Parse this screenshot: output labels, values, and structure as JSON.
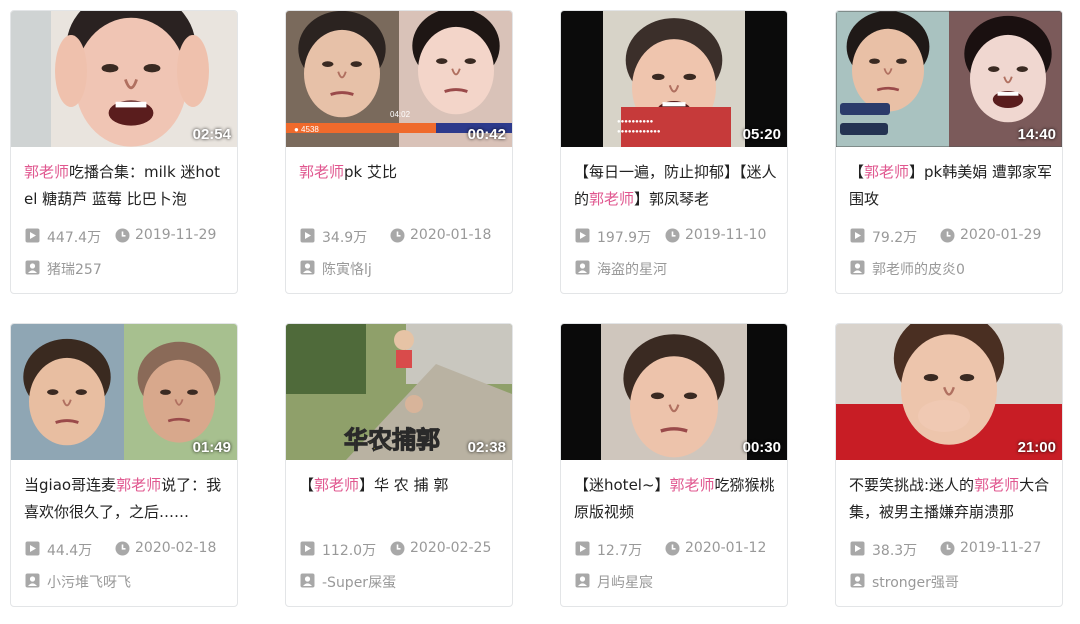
{
  "colors": {
    "highlight": "#e0578f",
    "meta": "#999999",
    "border": "#e3e5e7"
  },
  "videos": [
    {
      "duration": "02:54",
      "title_parts": [
        {
          "t": "郭老师",
          "hl": true
        },
        {
          "t": "吃播合集：milk 迷hotel 糖葫芦 蓝莓 比巴卜泡",
          "hl": false
        }
      ],
      "views": "447.4万",
      "date": "2019-11-29",
      "uploader": "猪瑞257",
      "thumb": "crying"
    },
    {
      "duration": "00:42",
      "title_parts": [
        {
          "t": "郭老师",
          "hl": true
        },
        {
          "t": "pk 艾比",
          "hl": false
        }
      ],
      "views": "34.9万",
      "date": "2020-01-18",
      "uploader": "陈寅恪lj",
      "thumb": "pk"
    },
    {
      "duration": "05:20",
      "title_parts": [
        {
          "t": "【每日一遍，防止抑郁】【迷人的",
          "hl": false
        },
        {
          "t": "郭老师",
          "hl": true
        },
        {
          "t": "】郭凤琴老",
          "hl": false
        }
      ],
      "views": "197.9万",
      "date": "2019-11-10",
      "uploader": "海盗的星河",
      "thumb": "live"
    },
    {
      "duration": "14:40",
      "title_parts": [
        {
          "t": "【",
          "hl": false
        },
        {
          "t": "郭老师",
          "hl": true
        },
        {
          "t": "】pk韩美娟 遭郭家军围攻",
          "hl": false
        }
      ],
      "views": "79.2万",
      "date": "2020-01-29",
      "uploader": "郭老师的皮炎0",
      "thumb": "pk2"
    },
    {
      "duration": "01:49",
      "title_parts": [
        {
          "t": "当giao哥连麦",
          "hl": false
        },
        {
          "t": "郭老师",
          "hl": true
        },
        {
          "t": "说了：我喜欢你很久了，之后……",
          "hl": false
        }
      ],
      "views": "44.4万",
      "date": "2020-02-18",
      "uploader": "小污堆飞呀飞",
      "thumb": "split"
    },
    {
      "duration": "02:38",
      "title_parts": [
        {
          "t": "【",
          "hl": false
        },
        {
          "t": "郭老师",
          "hl": true
        },
        {
          "t": "】华 农 捕 郭",
          "hl": false
        }
      ],
      "views": "112.0万",
      "date": "2020-02-25",
      "uploader": "-Super屎蛋",
      "thumb": "road",
      "overlay": "华农捕郭"
    },
    {
      "duration": "00:30",
      "title_parts": [
        {
          "t": "【迷hotel~】",
          "hl": false
        },
        {
          "t": "郭老师",
          "hl": true
        },
        {
          "t": "吃猕猴桃原版视频",
          "hl": false
        }
      ],
      "views": "12.7万",
      "date": "2020-01-12",
      "uploader": "月屿星宸",
      "thumb": "dark"
    },
    {
      "duration": "21:00",
      "title_parts": [
        {
          "t": "不要笑挑战:迷人的",
          "hl": false
        },
        {
          "t": "郭老师",
          "hl": true
        },
        {
          "t": "大合集，被男主播嫌弃崩溃那",
          "hl": false
        }
      ],
      "views": "38.3万",
      "date": "2019-11-27",
      "uploader": "stronger强哥",
      "thumb": "red"
    }
  ],
  "icons": {
    "views": "play-count-icon",
    "date": "clock-icon",
    "uploader": "user-icon"
  }
}
